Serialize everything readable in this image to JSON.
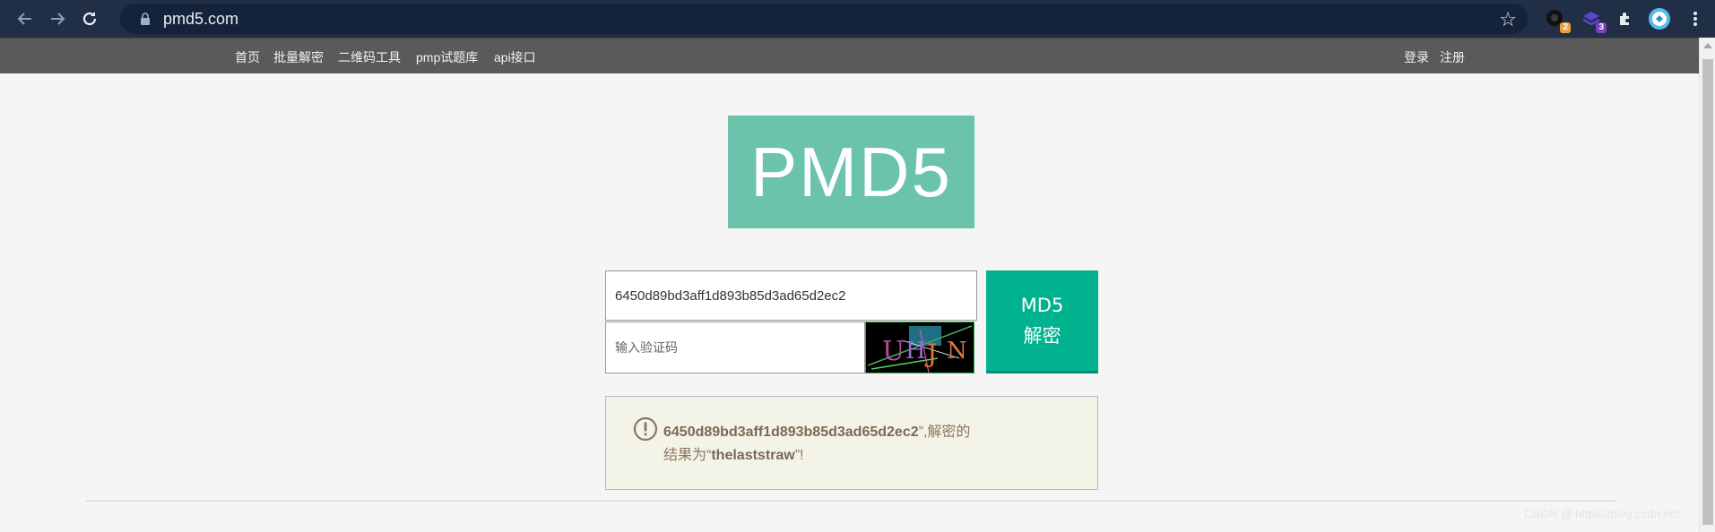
{
  "browser": {
    "url": "pmd5.com",
    "extensions": [
      {
        "name": "ext-1",
        "badge": "2",
        "badge_color": "#e8a33c"
      },
      {
        "name": "ext-2",
        "badge": "3",
        "badge_color": "#7b3fc4"
      }
    ]
  },
  "nav": {
    "left_links": [
      "首页",
      "批量解密",
      "二维码工具",
      "pmp试题库",
      "api接口"
    ],
    "login": "登录",
    "register": "注册"
  },
  "logo": {
    "text": "PMD5",
    "bg_color": "#6cc3ab"
  },
  "form": {
    "hash_value": "6450d89bd3aff1d893b85d3ad65d2ec2",
    "captcha_placeholder": "输入验证码",
    "captcha_text": "UHJN",
    "button_line1": "MD5",
    "button_line2": "解密",
    "button_color": "#00b38e"
  },
  "result": {
    "hash": "6450d89bd3aff1d893b85d3ad65d2ec2",
    "mid": "”,解密的",
    "prefix2": "结果为“",
    "plain": "thelaststraw",
    "suffix": "”!"
  },
  "watermark": "CSDN @ https://blog.csdn.net"
}
